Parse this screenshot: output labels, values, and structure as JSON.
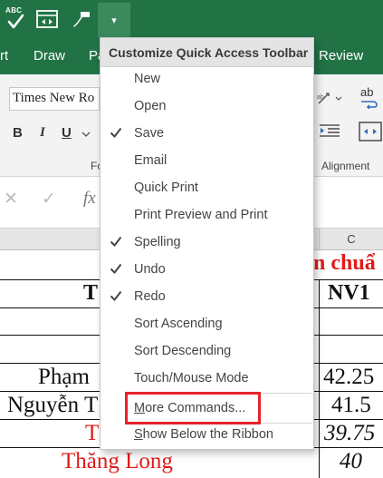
{
  "qat": {
    "spelling_icon_text": "ABC",
    "customize_arrow": "▾"
  },
  "tabs": [
    {
      "label": "rt"
    },
    {
      "label": "Draw"
    },
    {
      "label": "Pa"
    },
    {
      "label": "Review"
    }
  ],
  "ribbon": {
    "font_name": "Times New Ro",
    "bold": "B",
    "italic": "I",
    "underline": "U",
    "font_group": "Fo",
    "alignment_group": "Alignment",
    "wrap_icon_text": "ab"
  },
  "formula_bar": {
    "cancel_glyph": "✕",
    "enter_glyph": "✓",
    "fx_label": "fx"
  },
  "column_header": {
    "C": "C"
  },
  "grid": {
    "row1_b": "n chuẩ",
    "row2_a": "T",
    "row2_c": "NV1",
    "row5_a": "Phạm",
    "row5_c": "42.25",
    "row6_a": "Nguyễn T",
    "row6_c": "41.5",
    "row7_a": "T",
    "row7_c": "39.75",
    "row8_a": "Thăng Long",
    "row8_c": "40"
  },
  "menu": {
    "title": "Customize Quick Access Toolbar",
    "items": [
      {
        "label": "New",
        "checked": false
      },
      {
        "label": "Open",
        "checked": false
      },
      {
        "label": "Save",
        "checked": true
      },
      {
        "label": "Email",
        "checked": false
      },
      {
        "label": "Quick Print",
        "checked": false
      },
      {
        "label": "Print Preview and Print",
        "checked": false
      },
      {
        "label": "Spelling",
        "checked": true
      },
      {
        "label": "Undo",
        "checked": true
      },
      {
        "label": "Redo",
        "checked": true
      },
      {
        "label": "Sort Ascending",
        "checked": false
      },
      {
        "label": "Sort Descending",
        "checked": false
      },
      {
        "label": "Touch/Mouse Mode",
        "checked": false
      }
    ],
    "more_commands": "More Commands...",
    "show_below": "Show Below the Ribbon"
  },
  "colors": {
    "excel_green": "#217346",
    "highlight_red": "#e3242b",
    "text_red": "#e01b1b"
  }
}
